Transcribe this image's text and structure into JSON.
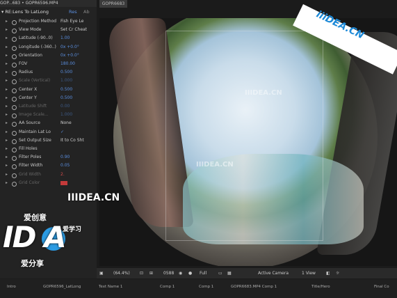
{
  "panel": {
    "header": "GOP...683 • GOPR6596.MP4",
    "effect_name": "RE:Lens To LatLong",
    "effect_reset": "Res",
    "effect_about": "Ab",
    "rows": [
      {
        "name": "Projection Method",
        "value": "Fish Eye Le",
        "type": "dropdown"
      },
      {
        "name": "View Mode",
        "value": "Set Cr Cheat",
        "type": "dropdown"
      },
      {
        "name": "Latitude (-90..0)",
        "value": "1.00",
        "type": "value"
      },
      {
        "name": "Longitude (-360..)",
        "value": "0x +0.0°",
        "type": "value"
      },
      {
        "name": "Orientation",
        "value": "0x +0.0°",
        "type": "value"
      },
      {
        "name": "FOV",
        "value": "180.00",
        "type": "value"
      },
      {
        "name": "Radius",
        "value": "0.500",
        "type": "value"
      },
      {
        "name": "Scale (Vertical)",
        "value": "1.000",
        "type": "value",
        "dim": true
      },
      {
        "name": "Center X",
        "value": "0.500",
        "type": "value"
      },
      {
        "name": "Center Y",
        "value": "0.500",
        "type": "value"
      },
      {
        "name": "Latitude Shift",
        "value": "0.00",
        "type": "value",
        "dim": true
      },
      {
        "name": "Image Scale...",
        "value": "1.000",
        "type": "value",
        "dim": true
      },
      {
        "name": "AA Source",
        "value": "None",
        "type": "dropdown"
      },
      {
        "name": "Maintain Lat Lo",
        "value": "✓",
        "type": "check"
      },
      {
        "name": "Set Output Size",
        "value": "It to Co Sht",
        "type": "dropdown"
      },
      {
        "name": "Fill Holes",
        "value": "",
        "type": "check"
      },
      {
        "name": "Filter Poles",
        "value": "0.90",
        "type": "value"
      },
      {
        "name": "Filter Width",
        "value": "0.05",
        "type": "value"
      },
      {
        "name": "Grid Width",
        "value": "2.",
        "type": "value",
        "dim": true,
        "red": true
      },
      {
        "name": "Grid Color",
        "value": "",
        "type": "color",
        "dim": true
      }
    ]
  },
  "viewer": {
    "tab": "GOPR6683"
  },
  "view_bar": {
    "zoom": "(64.4%)",
    "timecode": "0588",
    "resolution": "Full",
    "camera": "Active Camera",
    "views": "1 View"
  },
  "timeline_tabs": [
    "Intro",
    "GOPR6596_LatLong",
    "Text Name 1",
    "Comp 1",
    "Comp 1",
    "GOPR6683.MP4 Comp 1",
    "Title/Hero",
    "Final Co"
  ],
  "watermarks": {
    "banner": "iiiDEA.CN",
    "middle": "IIIDEA.CN",
    "top_middle": "IIIDEA.CN",
    "left": "IIIDEA.CN",
    "logo_big": "ID A",
    "logo_cn_top": "爱创意",
    "logo_cn_right": "爱学习",
    "logo_cn_bottom": "爱分享"
  },
  "colors": {
    "value_blue": "#5b8fe0",
    "panel_bg": "#232323",
    "accent_brand": "#1d8ad8"
  }
}
